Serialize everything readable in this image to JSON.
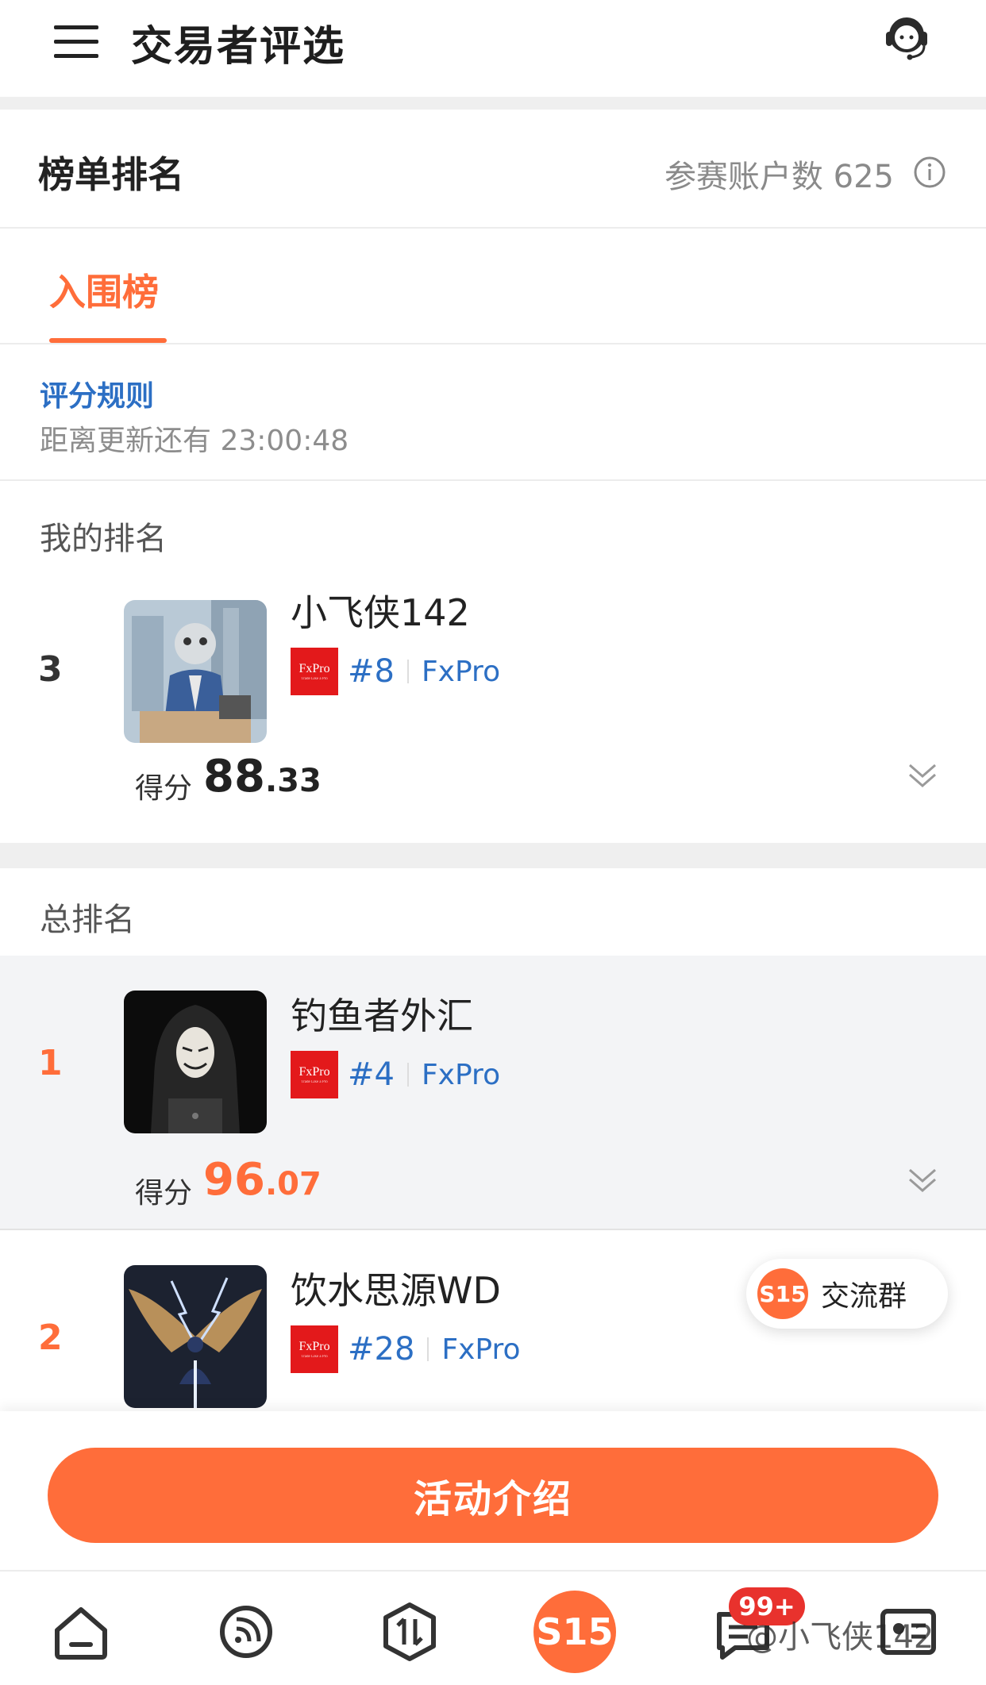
{
  "header": {
    "title": "交易者评选",
    "menu_icon": "hamburger-menu-icon",
    "support_icon": "headset-support-icon"
  },
  "ranking": {
    "title": "榜单排名",
    "participants_label": "参赛账户数 625",
    "info_icon": "info-circle-icon"
  },
  "tabs": [
    {
      "label": "入围榜",
      "active": true
    }
  ],
  "rules": {
    "link": "评分规则",
    "countdown": "距离更新还有 23:00:48"
  },
  "my_rank": {
    "label": "我的排名",
    "entry": {
      "rank": "3",
      "name": "小飞侠142",
      "account": "#8",
      "broker": "FxPro",
      "score_label": "得分",
      "score_int": "88",
      "score_dec": ".33"
    }
  },
  "overall": {
    "label": "总排名",
    "entries": [
      {
        "rank": "1",
        "name": "钓鱼者外汇",
        "account": "#4",
        "broker": "FxPro",
        "score_label": "得分",
        "score_int": "96",
        "score_dec": ".07"
      },
      {
        "rank": "2",
        "name": "饮水思源WD",
        "account": "#28",
        "broker": "FxPro"
      }
    ]
  },
  "floating_pill": {
    "badge": "S15",
    "label": "交流群"
  },
  "cta": {
    "label": "活动介绍"
  },
  "bottom_nav": {
    "center_label": "S15",
    "badge": "99+"
  },
  "watermark": "@小飞侠142",
  "broker_logo_text": "FxPro",
  "colors": {
    "accent": "#ff6d3a",
    "link": "#2c6fc4",
    "badge_red": "#e8322d",
    "broker_red": "#e3191b"
  }
}
